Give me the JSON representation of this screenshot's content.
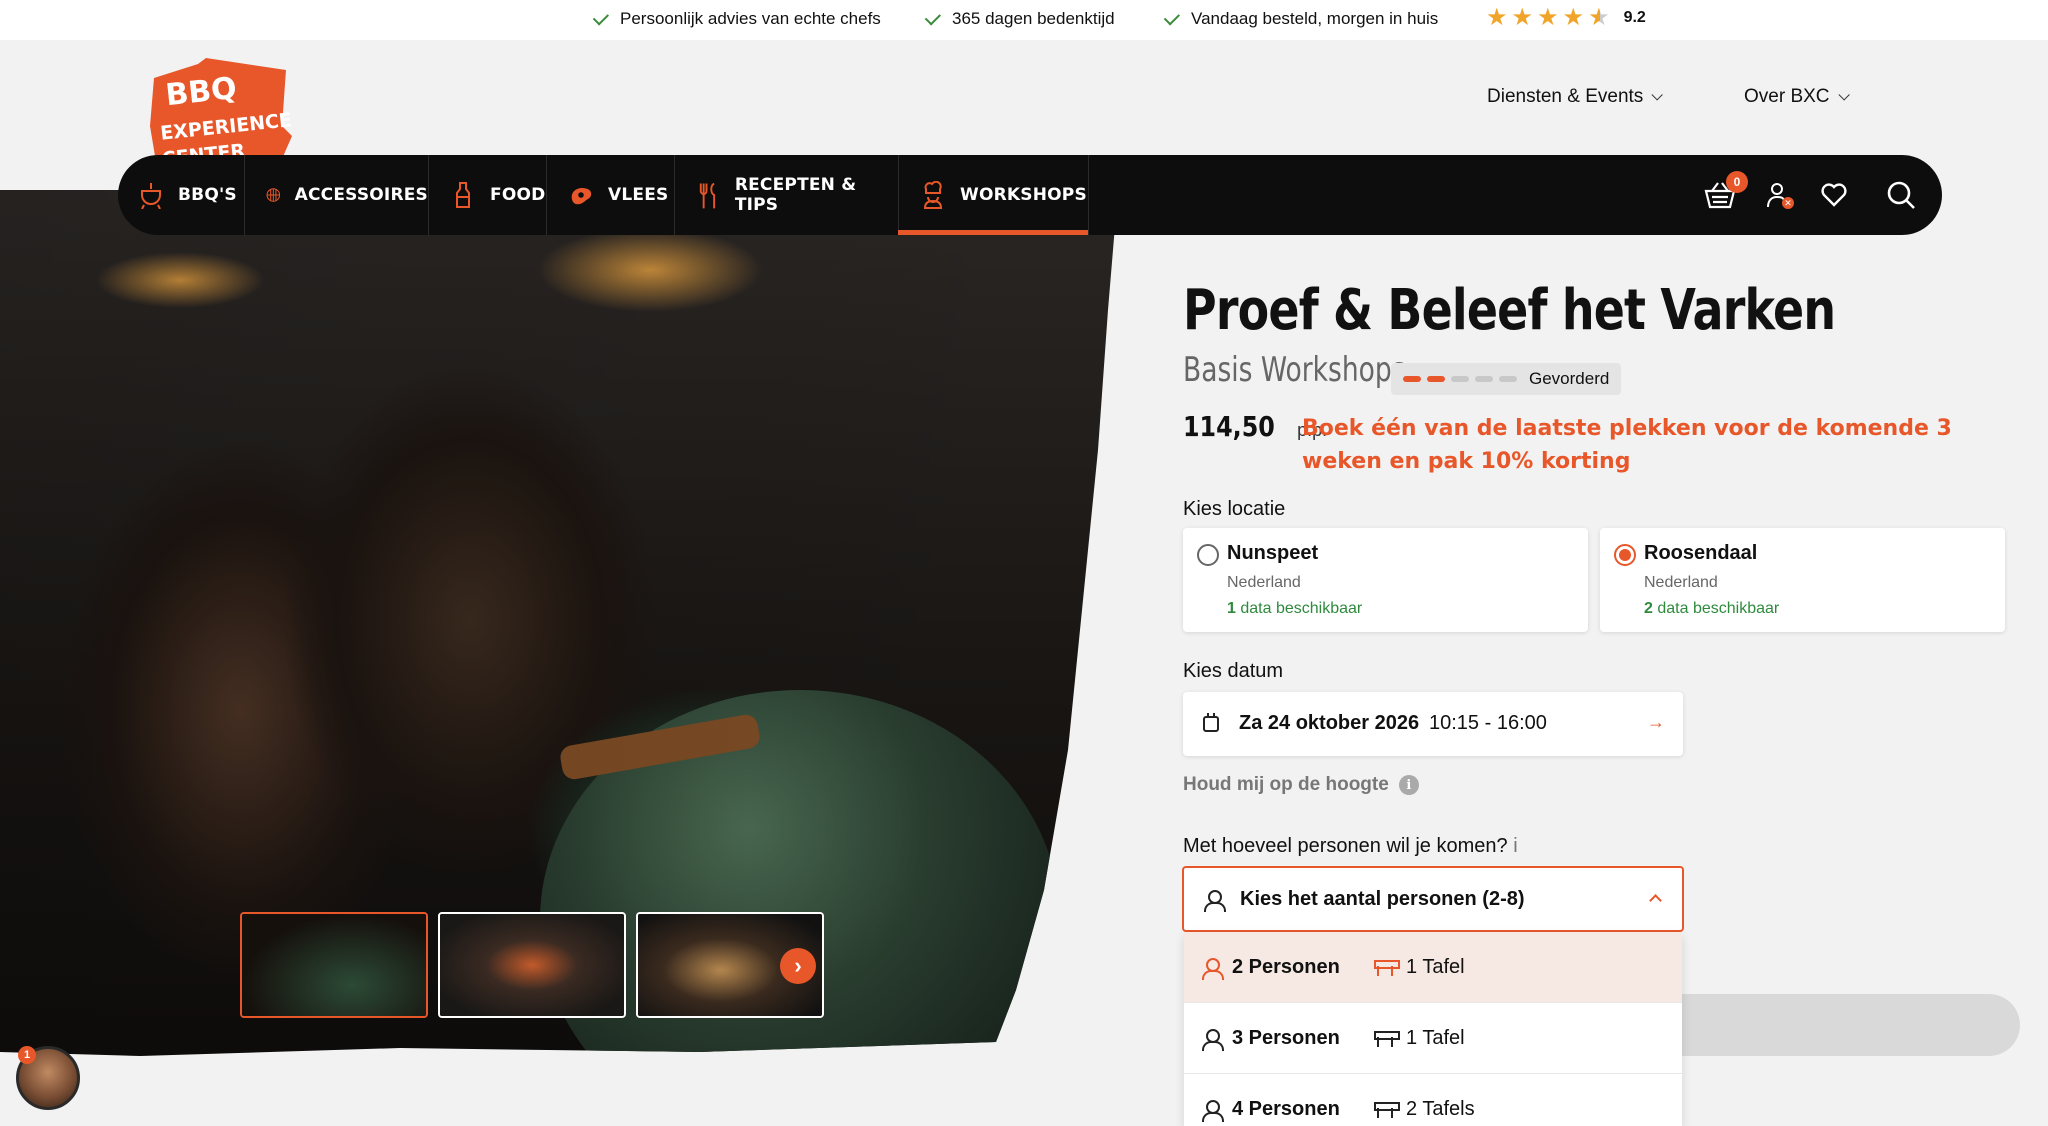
{
  "usp": [
    {
      "text": "Persoonlijk advies van echte chefs"
    },
    {
      "text": "365 dagen bedenktijd"
    },
    {
      "text": "Vandaag besteld, morgen in huis"
    }
  ],
  "rating": {
    "value": "9.2",
    "stars": 4.5
  },
  "logo": {
    "line1": "BBQ",
    "line2": "EXPERIENCE",
    "line3": "CENTER"
  },
  "header_links": [
    {
      "label": "Diensten & Events"
    },
    {
      "label": "Over BXC"
    }
  ],
  "nav": {
    "items": [
      {
        "label": "BBQ'S",
        "icon": "bbq-icon"
      },
      {
        "label": "ACCESSOIRES",
        "icon": "grill-grate-icon"
      },
      {
        "label": "FOOD",
        "icon": "bottle-icon"
      },
      {
        "label": "VLEES",
        "icon": "steak-icon"
      },
      {
        "label": "RECEPTEN & TIPS",
        "icon": "cutlery-icon"
      },
      {
        "label": "WORKSHOPS",
        "icon": "chef-icon",
        "active": true
      }
    ],
    "cart_count": "0"
  },
  "gallery": {
    "avatar_badge": "1"
  },
  "product": {
    "title": "Proef & Beleef het Varken",
    "category": "Basis Workshops",
    "level_label": "Gevorderd",
    "level": 2,
    "level_max": 5,
    "price": "114,50",
    "price_unit": "p.p.",
    "promo": "Boek één van de laatste plekken voor de komende 3 weken en pak 10% korting"
  },
  "location": {
    "label": "Kies locatie",
    "options": [
      {
        "name": "Nunspeet",
        "country": "Nederland",
        "count": "1",
        "avail_suffix": " data beschikbaar",
        "selected": false
      },
      {
        "name": "Roosendaal",
        "country": "Nederland",
        "count": "2",
        "avail_suffix": " data beschikbaar",
        "selected": true
      }
    ]
  },
  "date": {
    "label": "Kies datum",
    "value": "Za 24 oktober 2026",
    "time": "10:15 - 16:00"
  },
  "notify": {
    "label": "Houd mij op de hoogte",
    "info": "i"
  },
  "persons": {
    "label": "Met hoeveel personen wil je komen?",
    "info": " i",
    "placeholder": "Kies het aantal personen (2-8)",
    "options": [
      {
        "persons": "2 Personen",
        "tables": "1 Tafel",
        "active": true
      },
      {
        "persons": "3 Personen",
        "tables": "1 Tafel",
        "active": false
      },
      {
        "persons": "4 Personen",
        "tables": "2 Tafels",
        "active": false
      }
    ]
  },
  "colors": {
    "accent": "#e8572a",
    "nav_bg": "#0d0d0d",
    "available": "#2f8a3e"
  }
}
